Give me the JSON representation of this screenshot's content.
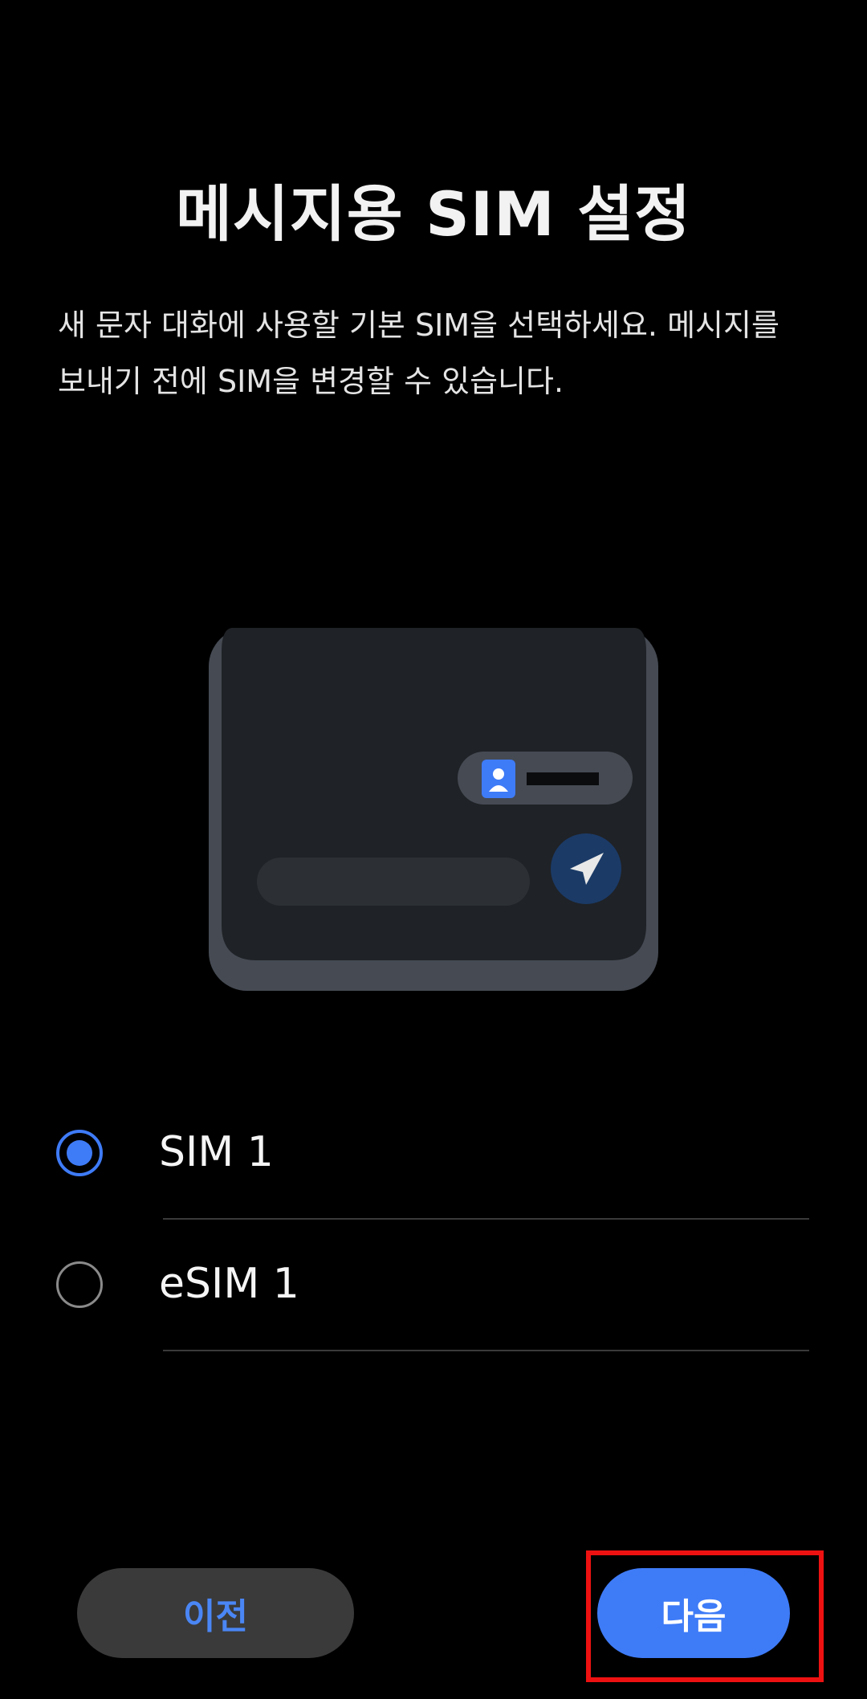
{
  "header": {
    "title": "메시지용 SIM 설정",
    "description": "새 문자 대화에 사용할 기본 SIM을 선택하세요. 메시지를 보내기 전에 SIM을 변경할 수 있습니다."
  },
  "illustration": {
    "icons": [
      "contact-icon",
      "send-icon"
    ]
  },
  "options": [
    {
      "label": "SIM 1",
      "selected": true
    },
    {
      "label": "eSIM 1",
      "selected": false
    }
  ],
  "footer": {
    "prev_label": "이전",
    "next_label": "다음"
  },
  "colors": {
    "accent": "#3e7bf7",
    "background": "#000000",
    "secondary_button": "#3a3a3a",
    "highlight": "#ee1111"
  }
}
